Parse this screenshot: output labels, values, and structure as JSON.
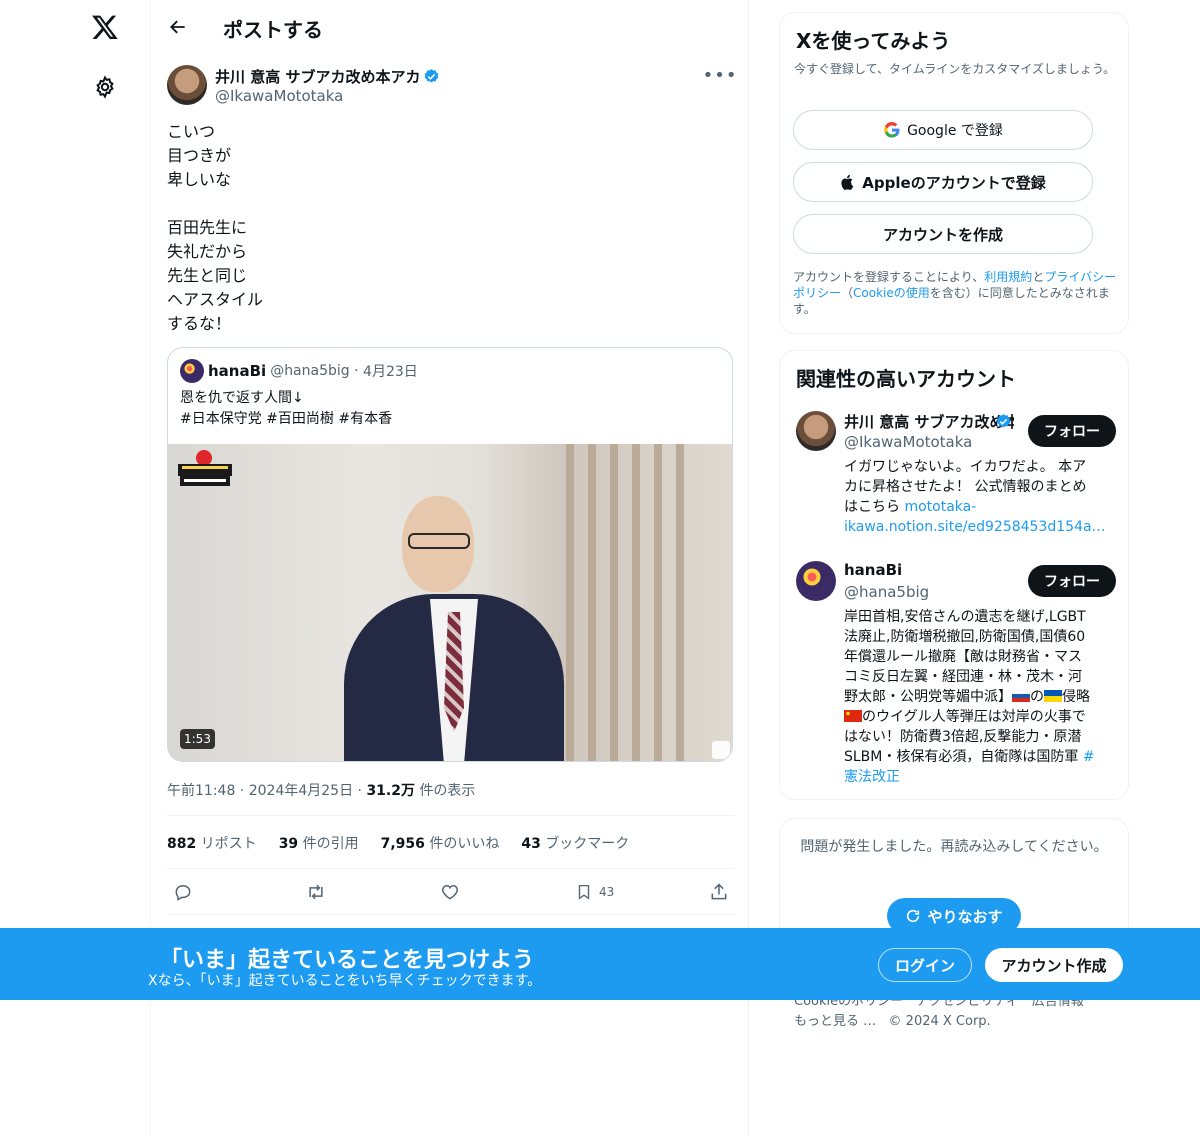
{
  "nav": {
    "logo": "x-logo-icon",
    "settings": "gear-icon"
  },
  "header": {
    "back_icon": "back-arrow-icon",
    "title": "ポストする"
  },
  "post": {
    "author_name": "井川 意高 サブアカ改め本アカ",
    "author_handle": "@IkawaMototaka",
    "text_lines": [
      "こいつ",
      "目つきが",
      "卑しいな",
      "",
      "百田先生に",
      "失礼だから",
      "先生と同じ",
      "ヘアスタイル",
      "するな！"
    ],
    "quote": {
      "name": "hanaBi",
      "handle": "@hana5big",
      "date": "4月23日",
      "text_lines": [
        "恩を仇で返す人間↓",
        "#日本保守党 #百田尚樹 #有本香"
      ],
      "video_duration": "1:53"
    },
    "time": "午前11:48",
    "date": "2024年4月25日",
    "views": "31.2万",
    "views_label": "件の表示",
    "stats": {
      "reposts": "882",
      "reposts_label": "リポスト",
      "quotes": "39",
      "quotes_label": "件の引用",
      "likes": "7,956",
      "likes_label": "件のいいね",
      "bookmarks": "43",
      "bookmarks_label": "ブックマーク"
    },
    "actions": {
      "bookmark_count": "43"
    }
  },
  "signup_card": {
    "title": "Xを使ってみよう",
    "subtitle": "今すぐ登録して、タイムラインをカスタマイズしましょう。",
    "google_btn": "Google で登録",
    "apple_btn": "Appleのアカウントで登録",
    "create_btn": "アカウントを作成",
    "legal_prefix": "アカウントを登録することにより、",
    "terms": "利用規約",
    "and": "と",
    "privacy": "プライバシーポリシー",
    "legal_mid": "（",
    "cookie": "Cookieの使用",
    "legal_suffix": "を含む）に同意したとみなされます。"
  },
  "related": {
    "title": "関連性の高いアカウント",
    "users": [
      {
        "name": "井川 意高 サブアカ改め本アカ",
        "handle": "@IkawaMototaka",
        "follow": "フォロー",
        "bio_lines": [
          "イガワじゃないよ。イカワだよ。 本ア",
          "カに昇格させたよ！ 公式情報のまとめ",
          "はこちら "
        ],
        "link1": "mototaka-",
        "link2": "ikawa.notion.site/ed9258453d154a…"
      },
      {
        "name": "hanaBi",
        "handle": "@hana5big",
        "follow": "フォロー",
        "bio_lines": [
          "岸田首相,安倍さんの遺志を継げ,LGBT",
          "法廃止,防衛増税撤回,防衛国債,国債60",
          "年償還ルール撤廃【敵は財務省・マス",
          "コミ反日左翼・経団連・林・茂木・河",
          "野太郎・公明党等媚中派】",
          "のウイグル人等弾圧は対岸の火事で",
          "はない！防衛費3倍超,反撃能力・原潜",
          "SLBM・核保有必須，自衛隊は国防軍 "
        ],
        "flag_text_mid": "の",
        "flag_text_end": "侵略",
        "hashtag1": "#",
        "hashtag2": "憲法改正"
      }
    ]
  },
  "error_card": {
    "message": "問題が発生しました。再読み込みしてください。",
    "retry": "やりなおす"
  },
  "footer": {
    "line1": "Cookieのポリシー　アクセシビリティ　広告情報",
    "more": "もっと見る …",
    "copyright": "© 2024 X Corp."
  },
  "banner": {
    "title": "「いま」起きていることを見つけよう",
    "subtitle": "Xなら、「いま」起きていることをいち早くチェックできます。",
    "login": "ログイン",
    "signup": "アカウント作成"
  },
  "colors": {
    "accent": "#1d9bf0",
    "text": "#0f1419",
    "muted": "#536471"
  }
}
